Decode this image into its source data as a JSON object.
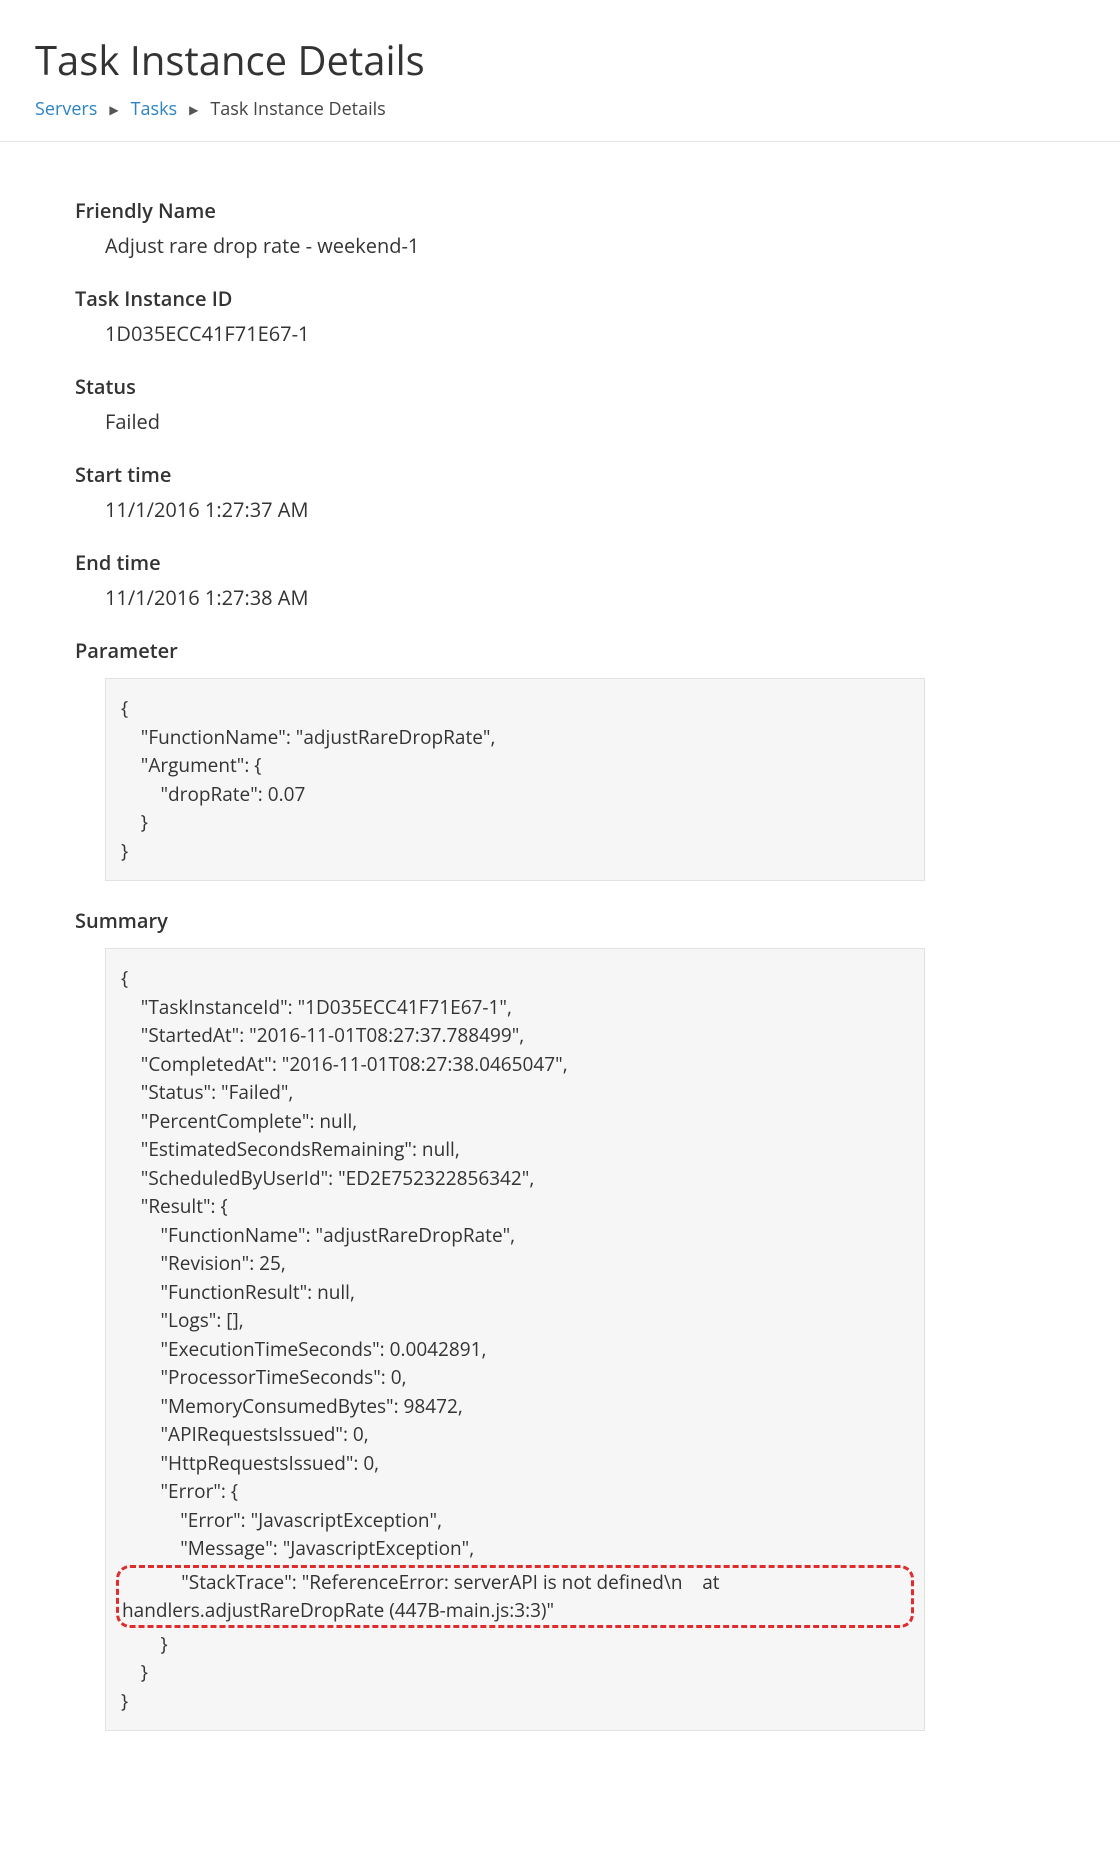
{
  "header": {
    "title": "Task Instance Details"
  },
  "breadcrumb": {
    "servers": "Servers",
    "tasks": "Tasks",
    "current": "Task Instance Details"
  },
  "labels": {
    "friendly_name": "Friendly Name",
    "task_instance_id": "Task Instance ID",
    "status": "Status",
    "start_time": "Start time",
    "end_time": "End time",
    "parameter": "Parameter",
    "summary": "Summary"
  },
  "values": {
    "friendly_name": "Adjust rare drop rate - weekend-1",
    "task_instance_id": "1D035ECC41F71E67-1",
    "status": "Failed",
    "start_time": "11/1/2016 1:27:37 AM",
    "end_time": "11/1/2016 1:27:38 AM"
  },
  "parameter_block": "{\n    \"FunctionName\": \"adjustRareDropRate\",\n    \"Argument\": {\n        \"dropRate\": 0.07\n    }\n}",
  "summary_block_pre": "{\n    \"TaskInstanceId\": \"1D035ECC41F71E67-1\",\n    \"StartedAt\": \"2016-11-01T08:27:37.788499\",\n    \"CompletedAt\": \"2016-11-01T08:27:38.0465047\",\n    \"Status\": \"Failed\",\n    \"PercentComplete\": null,\n    \"EstimatedSecondsRemaining\": null,\n    \"ScheduledByUserId\": \"ED2E752322856342\",\n    \"Result\": {\n        \"FunctionName\": \"adjustRareDropRate\",\n        \"Revision\": 25,\n        \"FunctionResult\": null,\n        \"Logs\": [],\n        \"ExecutionTimeSeconds\": 0.0042891,\n        \"ProcessorTimeSeconds\": 0,\n        \"MemoryConsumedBytes\": 98472,\n        \"APIRequestsIssued\": 0,\n        \"HttpRequestsIssued\": 0,\n        \"Error\": {\n            \"Error\": \"JavascriptException\",\n            \"Message\": \"JavascriptException\",",
  "summary_block_highlight": "            \"StackTrace\": \"ReferenceError: serverAPI is not defined\\n    at handlers.adjustRareDropRate (447B-main.js:3:3)\"",
  "summary_block_post": "        }\n    }\n}"
}
